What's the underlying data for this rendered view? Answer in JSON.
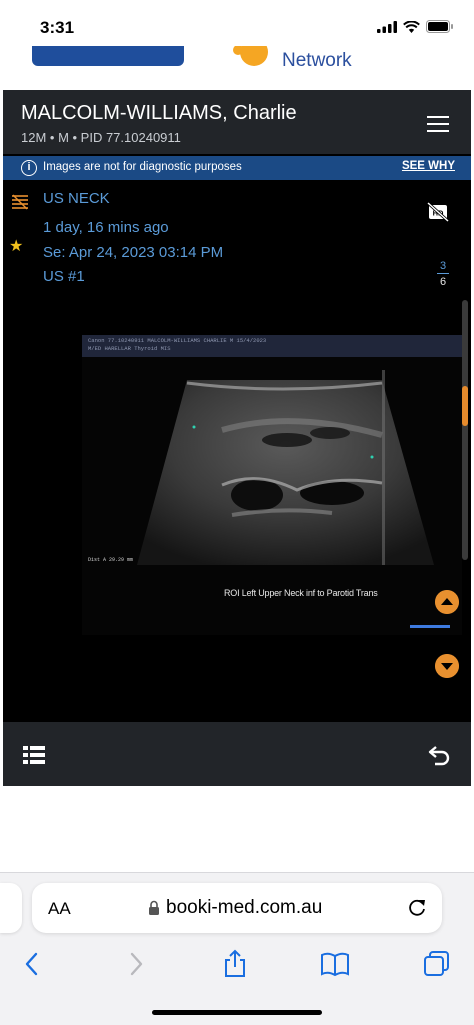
{
  "status_bar": {
    "time": "3:31"
  },
  "site_header": {
    "network_text": "Network"
  },
  "patient": {
    "name": "MALCOLM-WILLIAMS, Charlie",
    "details": "12M • M • PID 77.10240911"
  },
  "notice": {
    "text": "Images are not for diagnostic purposes",
    "link": "SEE WHY"
  },
  "study": {
    "title": "US NECK",
    "relative_time": "1 day, 16 mins ago",
    "series_date": "Se: Apr 24, 2023 03:14 PM",
    "series_label": "US #1"
  },
  "pager": {
    "current": "3",
    "total": "6"
  },
  "ultrasound": {
    "header_line1": "Canon   77.10240911 MALCOLM-WILLIAMS CHARLIE        M   15/4/2023",
    "header_line2": "        M/ED HARELLAR                 Thyroid         MIS",
    "caption": "ROI Left  Upper Neck   inf to Parotid     Trans",
    "measure": "Dist A     29.29 mm"
  },
  "browser": {
    "aa": "AA",
    "url": "booki-med.com.au"
  },
  "colors": {
    "accent": "#e8902f",
    "link_blue": "#5b9bd8",
    "notice_bg": "#1b4a85",
    "panel_bg": "#222529"
  }
}
